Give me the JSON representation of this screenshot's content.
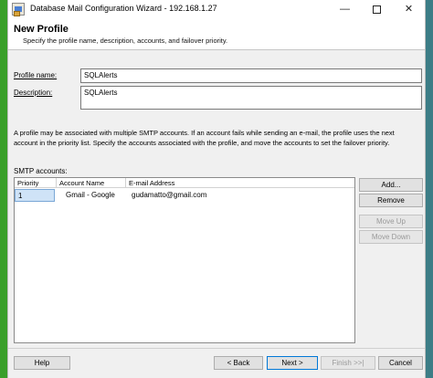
{
  "window": {
    "title": "Database Mail Configuration Wizard - 192.168.1.27",
    "minimize_icon": "minimize-icon",
    "maximize_icon": "maximize-icon",
    "close_icon": "close-icon",
    "app_icon": "database-mail-icon"
  },
  "header": {
    "title": "New Profile",
    "subtitle": "Specify the profile name, description, accounts, and failover priority."
  },
  "form": {
    "profile_name_label": "Profile name:",
    "profile_name_value": "SQLAlerts",
    "description_label": "Description:",
    "description_value": "SQLAlerts"
  },
  "info": {
    "text": "A profile may be associated with multiple SMTP accounts. If an account fails while sending an e-mail, the profile uses the next account in the priority list. Specify the accounts associated with the profile, and move the accounts to set the failover priority."
  },
  "smtp": {
    "label": "SMTP accounts:",
    "columns": [
      "Priority",
      "Account Name",
      "E-mail Address"
    ],
    "rows": [
      {
        "priority": "1",
        "account_name": "Gmail - Google",
        "email": "gudamatto@gmail.com"
      }
    ],
    "buttons": {
      "add": "Add...",
      "remove": "Remove",
      "move_up": "Move Up",
      "move_down": "Move Down"
    }
  },
  "footer": {
    "help": "Help",
    "back": "< Back",
    "next": "Next >",
    "finish": "Finish >>|",
    "cancel": "Cancel"
  },
  "colors": {
    "accent": "#0078d7",
    "selection": "#cfe3f7"
  }
}
